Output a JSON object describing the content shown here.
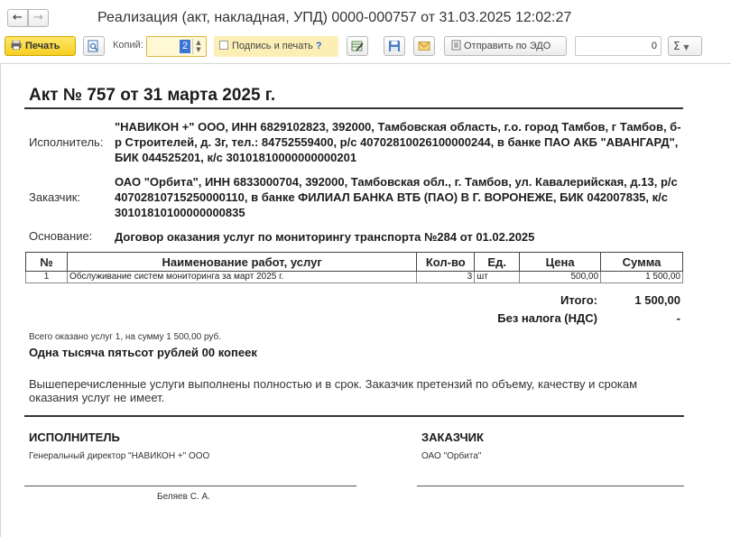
{
  "window": {
    "title": "Реализация (акт, накладная, УПД) 0000-000757 от 31.03.2025 12:02:27",
    "back_icon": "arrow-left-icon",
    "forward_icon": "arrow-right-icon"
  },
  "toolbar": {
    "print_label": "Печать",
    "copies_label": "Копий:",
    "copies_value": "2",
    "sign_print_label": "Подпись и печать",
    "sign_help": "?",
    "edo_label": "Отправить по ЭДО",
    "number_value": "0",
    "sum_label": "Σ"
  },
  "document": {
    "heading": "Акт № 757 от 31 марта 2025 г.",
    "executor_label": "Исполнитель:",
    "executor_text": "\"НАВИКОН +\" ООО, ИНН 6829102823, 392000, Тамбовская область, г.о. город Тамбов, г Тамбов, б-р Строителей, д. 3г, тел.: 84752559400, р/с 40702810026100000244, в банке ПАО АКБ \"АВАНГАРД\", БИК 044525201, к/с 30101810000000000201",
    "customer_label": "Заказчик:",
    "customer_text": "ОАО \"Орбита\", ИНН 6833000704, 392000, Тамбовская обл., г. Тамбов, ул. Кавалерийская, д.13, р/с 40702810715250000110, в банке ФИЛИАЛ БАНКА ВТБ (ПАО) В Г. ВОРОНЕЖЕ, БИК 042007835, к/с 30101810100000000835",
    "basis_label": "Основание:",
    "basis_text": "Договор оказания услуг по мониторингу транспорта №284 от 01.02.2025",
    "table": {
      "headers": [
        "№",
        "Наименование работ, услуг",
        "Кол-во",
        "Ед.",
        "Цена",
        "Сумма"
      ],
      "rows": [
        [
          "1",
          "Обслуживание систем мониторинга за март 2025 г.",
          "3",
          "шт",
          "500,00",
          "1 500,00"
        ]
      ]
    },
    "total_label": "Итого:",
    "total_value": "1 500,00",
    "vat_label": "Без налога (НДС)",
    "vat_value": "-",
    "summary_small": "Всего оказано услуг 1, на сумму 1 500,00 руб.",
    "summary_words": "Одна тысяча пятьсот рублей 00 копеек",
    "note": "Вышеперечисленные услуги выполнены полностью и в срок. Заказчик претензий по объему, качеству и срокам оказания услуг не имеет.",
    "executor_sig_title": "ИСПОЛНИТЕЛЬ",
    "executor_sig_position": "Генеральный директор  \"НАВИКОН +\" ООО",
    "executor_sig_name": "Беляев С. А.",
    "customer_sig_title": "ЗАКАЗЧИК",
    "customer_sig_org": "ОАО \"Орбита\""
  }
}
